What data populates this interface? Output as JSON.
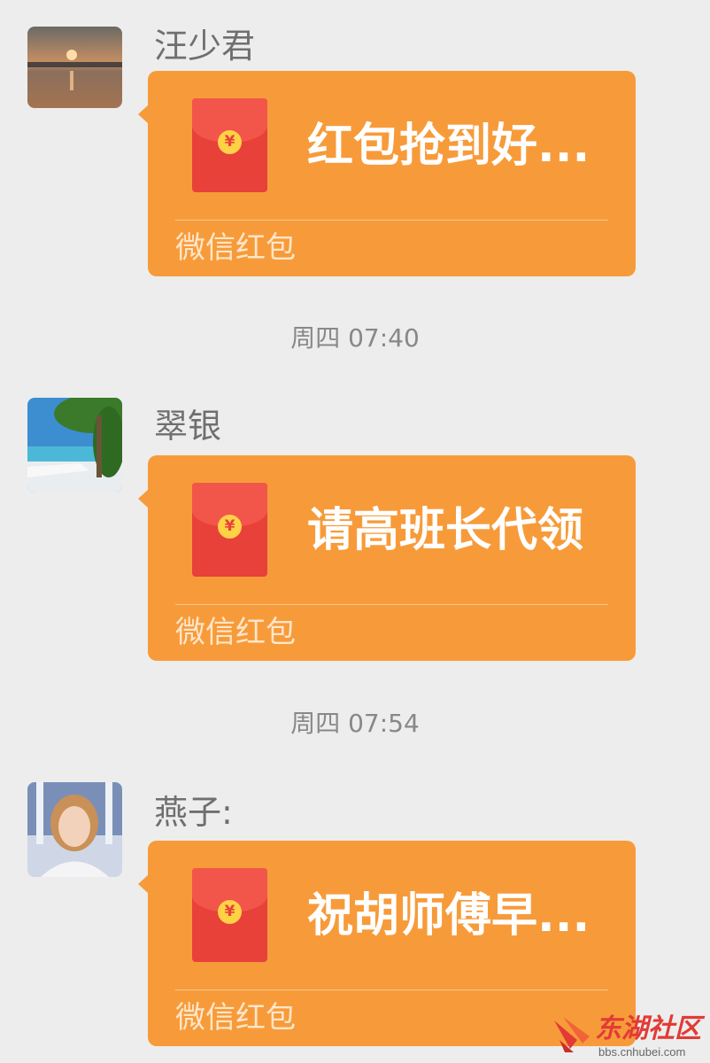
{
  "messages": [
    {
      "sender": "汪少君",
      "avatar": "sunset-avatar",
      "greeting": "红包抢到好...",
      "source": "微信红包"
    },
    {
      "sender": "翠银",
      "avatar": "beach-avatar",
      "greeting": "请高班长代领",
      "source": "微信红包"
    },
    {
      "sender": "燕子:",
      "avatar": "portrait-avatar",
      "greeting": "祝胡师傅早...",
      "source": "微信红包"
    }
  ],
  "timestamps": [
    "周四 07:40",
    "周四 07:54"
  ],
  "envelope_symbol": "¥",
  "watermark": {
    "name": "东湖社区",
    "url": "bbs.cnhubei.com"
  },
  "colors": {
    "background": "#ededed",
    "bubble": "#f79b3a",
    "envelope": "#e8413a",
    "coin": "#ffd246"
  }
}
